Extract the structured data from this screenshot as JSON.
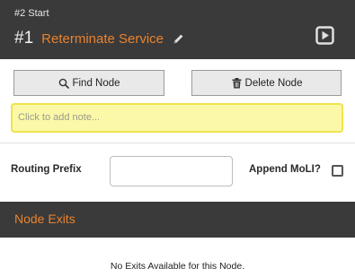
{
  "header": {
    "subtitle": "#2 Start",
    "number": "#1",
    "name": "Reterminate Service",
    "edit_icon": "pencil-icon",
    "play_icon": "play-icon",
    "background": "#3a3a3a",
    "accent": "#e8822e"
  },
  "actions": {
    "find_label": "Find Node",
    "find_icon": "search-icon",
    "delete_label": "Delete Node",
    "delete_icon": "trash-icon",
    "note_placeholder": "Click to add note...",
    "note_color": "#fbf9a8"
  },
  "routing": {
    "prefix_label": "Routing Prefix",
    "prefix_value": "",
    "append_label": "Append MoLI?",
    "append_checked": false
  },
  "exits": {
    "title": "Node Exits",
    "empty_text": "No Exits Available for this Node."
  }
}
